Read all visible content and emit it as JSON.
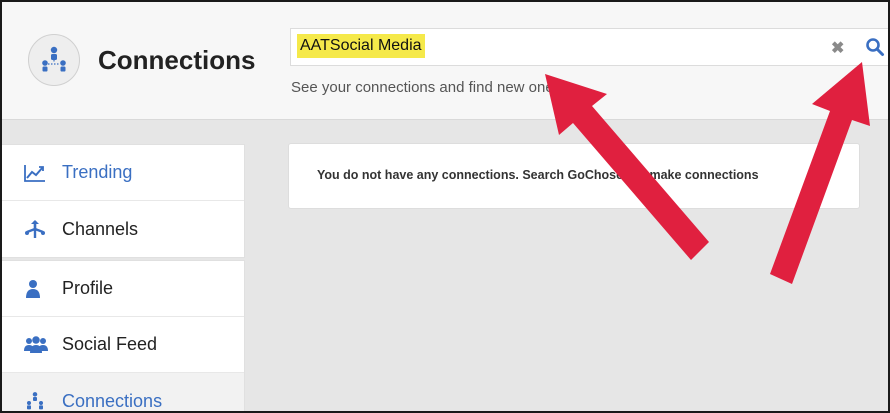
{
  "header": {
    "title": "Connections",
    "icon": "connections-icon",
    "search": {
      "value": "AATSocial Media",
      "clear_icon": "close-icon",
      "search_icon": "search-icon"
    },
    "subtitle": "See your connections and find new ones"
  },
  "sidebar": {
    "groups": [
      [
        {
          "label": "Trending",
          "icon": "trending-chart-icon",
          "style": "link"
        },
        {
          "label": "Channels",
          "icon": "channels-icon",
          "style": "normal"
        }
      ],
      [
        {
          "label": "Profile",
          "icon": "user-icon",
          "style": "normal"
        },
        {
          "label": "Social Feed",
          "icon": "users-icon",
          "style": "normal"
        },
        {
          "label": "Connections",
          "icon": "connections-icon",
          "style": "active"
        }
      ]
    ]
  },
  "main": {
    "notice": "You do not have any connections. Search GoChosen to make connections"
  },
  "colors": {
    "accent": "#3a6fc2",
    "highlight": "#f5e94a",
    "annotation_arrow": "#e0203f"
  }
}
